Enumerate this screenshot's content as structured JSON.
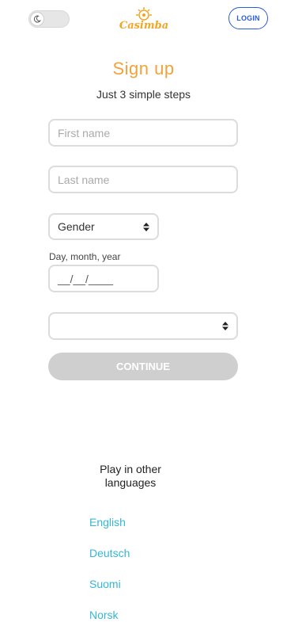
{
  "header": {
    "login_label": "LOGIN",
    "logo_text": "Casimba",
    "theme_icon": "moon-icon"
  },
  "signup": {
    "title": "Sign up",
    "subtitle": "Just 3 simple steps",
    "first_name_placeholder": "First name",
    "last_name_placeholder": "Last name",
    "gender_value": "Gender",
    "dob_label": "Day, month, year",
    "dob_value": "__/__/____",
    "country_value": "",
    "continue_label": "CONTINUE"
  },
  "languages": {
    "title": "Play in other languages",
    "items": [
      "English",
      "Deutsch",
      "Suomi",
      "Norsk"
    ]
  },
  "colors": {
    "accent": "#f2a23a",
    "link": "#35b6d6",
    "login": "#2a5bd7",
    "disabled_button": "#cfcfcf"
  }
}
